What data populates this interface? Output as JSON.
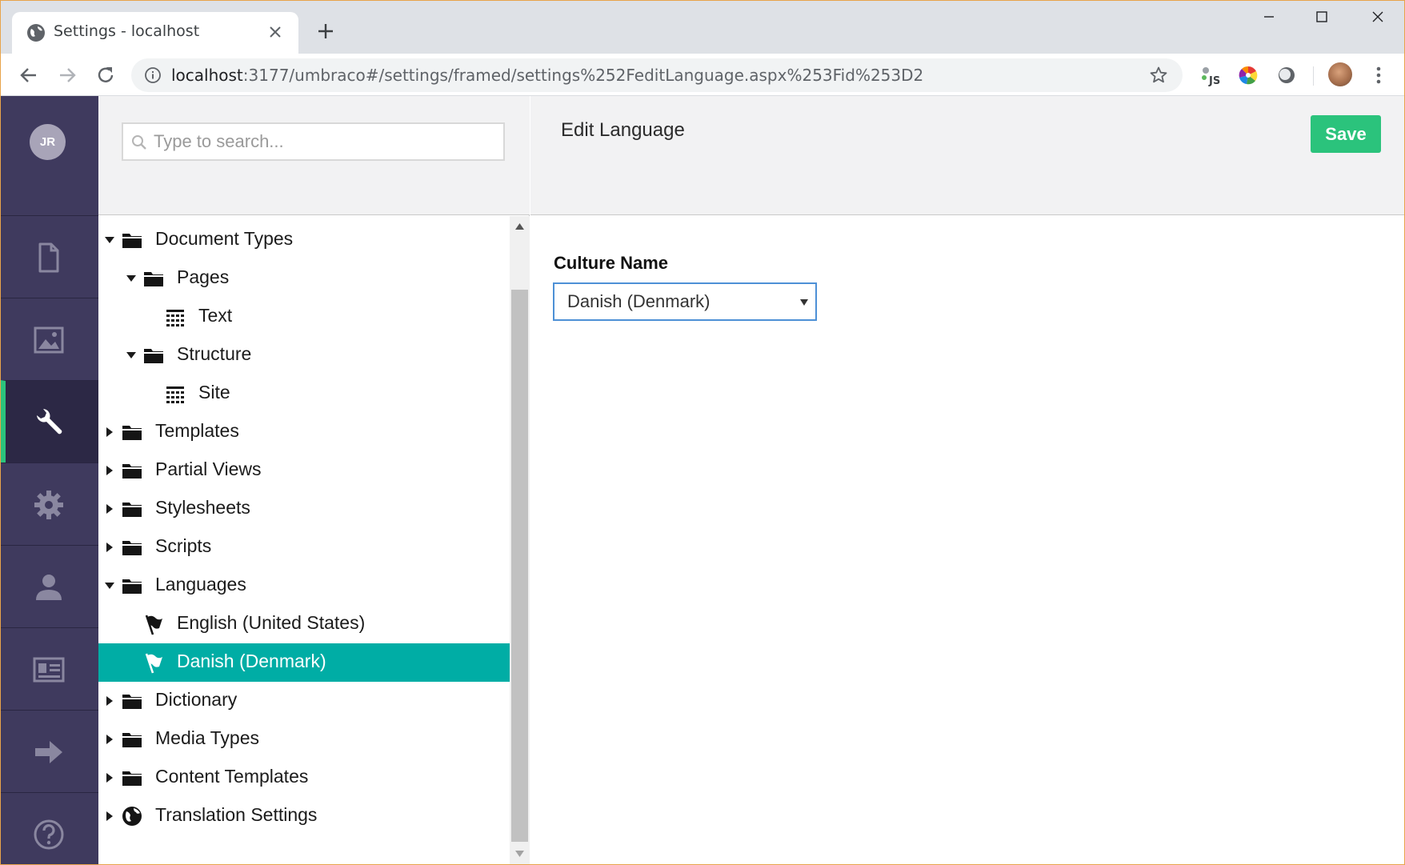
{
  "browser": {
    "tab_title": "Settings - localhost",
    "url_host": "localhost",
    "url_rest": ":3177/umbraco#/settings/framed/settings%252FeditLanguage.aspx%253Fid%253D2"
  },
  "sidebar": {
    "user_initials": "JR",
    "items": [
      {
        "icon": "content-icon"
      },
      {
        "icon": "media-icon"
      },
      {
        "icon": "settings-wrench-icon",
        "active": true
      },
      {
        "icon": "developer-gear-icon"
      },
      {
        "icon": "users-icon"
      },
      {
        "icon": "members-icon"
      },
      {
        "icon": "forms-arrow-icon"
      },
      {
        "icon": "help-icon"
      }
    ]
  },
  "search": {
    "placeholder": "Type to search..."
  },
  "tree": [
    {
      "label": "Document Types",
      "level": 0,
      "expanded": true,
      "icon": "folder-icon"
    },
    {
      "label": "Pages",
      "level": 1,
      "expanded": true,
      "icon": "folder-icon"
    },
    {
      "label": "Text",
      "level": 2,
      "icon": "doctype-grid-icon"
    },
    {
      "label": "Structure",
      "level": 1,
      "expanded": true,
      "icon": "folder-icon"
    },
    {
      "label": "Site",
      "level": 2,
      "icon": "doctype-grid-icon"
    },
    {
      "label": "Templates",
      "level": 0,
      "expanded": false,
      "icon": "folder-icon"
    },
    {
      "label": "Partial Views",
      "level": 0,
      "expanded": false,
      "icon": "folder-icon"
    },
    {
      "label": "Stylesheets",
      "level": 0,
      "expanded": false,
      "icon": "folder-icon"
    },
    {
      "label": "Scripts",
      "level": 0,
      "expanded": false,
      "icon": "folder-icon"
    },
    {
      "label": "Languages",
      "level": 0,
      "expanded": true,
      "icon": "folder-icon"
    },
    {
      "label": "English (United States)",
      "level": 1,
      "icon": "flag-icon"
    },
    {
      "label": "Danish (Denmark)",
      "level": 1,
      "icon": "flag-icon",
      "selected": true
    },
    {
      "label": "Dictionary",
      "level": 0,
      "expanded": false,
      "icon": "folder-icon"
    },
    {
      "label": "Media Types",
      "level": 0,
      "expanded": false,
      "icon": "folder-icon"
    },
    {
      "label": "Content Templates",
      "level": 0,
      "expanded": false,
      "icon": "folder-icon"
    },
    {
      "label": "Translation Settings",
      "level": 0,
      "expanded": false,
      "icon": "globe-icon"
    }
  ],
  "editor": {
    "title": "Edit Language",
    "save_label": "Save",
    "field_label": "Culture Name",
    "culture_value": "Danish (Denmark)"
  },
  "colors": {
    "sidebar_bg": "#3f3a5e",
    "accent_green": "#2bc37c",
    "selected_teal": "#00ada5",
    "select_border": "#4d90d6"
  }
}
